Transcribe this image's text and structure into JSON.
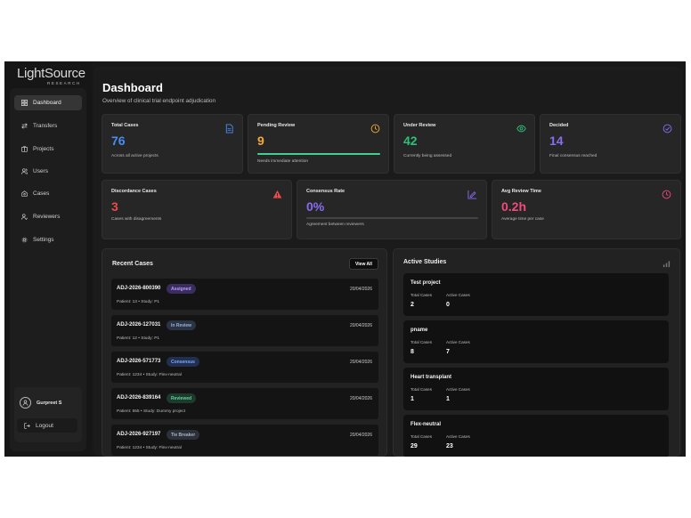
{
  "brand": {
    "name": "LightSource",
    "sub": "RESEARCH"
  },
  "sidebar": {
    "items": [
      {
        "label": "Dashboard",
        "icon": "dashboard-icon",
        "active": true
      },
      {
        "label": "Transfers",
        "icon": "transfer-icon"
      },
      {
        "label": "Projects",
        "icon": "folder-icon"
      },
      {
        "label": "Users",
        "icon": "users-icon"
      },
      {
        "label": "Cases",
        "icon": "cases-icon"
      },
      {
        "label": "Reviewers",
        "icon": "reviewers-icon"
      },
      {
        "label": "Settings",
        "icon": "gear-icon"
      }
    ],
    "user": {
      "name": "Gurpreet S"
    },
    "logout_label": "Logout"
  },
  "header": {
    "title": "Dashboard",
    "subtitle": "Overview of clinical trial endpoint adjudication"
  },
  "stats_row1": [
    {
      "title": "Total Cases",
      "value": "76",
      "desc": "Across all active projects",
      "color": "#4a8cf0",
      "icon": "document-icon"
    },
    {
      "title": "Pending Review",
      "value": "9",
      "desc": "Needs immediate attention",
      "color": "#f2a93b",
      "icon": "clock-icon",
      "progress": 1.0,
      "bar_color": "#3fcf8e"
    },
    {
      "title": "Under Review",
      "value": "42",
      "desc": "Currently being assessed",
      "color": "#2fbf7a",
      "icon": "eye-icon"
    },
    {
      "title": "Decided",
      "value": "14",
      "desc": "Final consensus reached",
      "color": "#8a6cf2",
      "icon": "check-circle-icon"
    }
  ],
  "stats_row2": [
    {
      "title": "Discordance Cases",
      "value": "3",
      "desc": "Cases with disagreements",
      "color": "#e84b4b",
      "icon": "warning-icon"
    },
    {
      "title": "Consensus Rate",
      "value": "0%",
      "desc": "Agreement between reviewers",
      "color": "#8a6cf2",
      "icon": "chart-edit-icon",
      "progress": 0.0
    },
    {
      "title": "Avg Review Time",
      "value": "0.2h",
      "desc": "Average time per case",
      "color": "#ef4b7e",
      "icon": "clock-icon"
    }
  ],
  "recent_cases": {
    "title": "Recent Cases",
    "view_all": "View All",
    "rows": [
      {
        "id": "ADJ-2026-800390",
        "status": "Assigned",
        "status_color": "#b79cff",
        "status_bg": "#3a2d5e",
        "date": "20/04/2026",
        "meta": "Patient: 13 • Study: P1"
      },
      {
        "id": "ADJ-2026-127031",
        "status": "In Review",
        "status_color": "#9ab0d8",
        "status_bg": "#2b3444",
        "date": "20/04/2026",
        "meta": "Patient: 12 • Study: P1"
      },
      {
        "id": "ADJ-2026-571773",
        "status": "Consensus",
        "status_color": "#7fa6ff",
        "status_bg": "#22304f",
        "date": "20/04/2026",
        "meta": "Patient: 1234 • Study: Flex-neutral"
      },
      {
        "id": "ADJ-2026-839164",
        "status": "Reviewed",
        "status_color": "#5fd39a",
        "status_bg": "#1f3a2c",
        "date": "20/04/2026",
        "meta": "Patient: 555 • Study: Dummy project"
      },
      {
        "id": "ADJ-2026-927197",
        "status": "Tie Breaker",
        "status_color": "#aab4c4",
        "status_bg": "#2c3038",
        "date": "20/04/2026",
        "meta": "Patient: 1234 • Study: Flex-neutral"
      }
    ]
  },
  "active_studies": {
    "title": "Active Studies",
    "total_label": "Total Cases",
    "active_label": "Active Cases",
    "items": [
      {
        "name": "Test project",
        "total": "2",
        "active": "0"
      },
      {
        "name": "pname",
        "total": "8",
        "active": "7"
      },
      {
        "name": "Heart transplant",
        "total": "1",
        "active": "1"
      },
      {
        "name": "Flex-neutral",
        "total": "29",
        "active": "23"
      }
    ]
  }
}
